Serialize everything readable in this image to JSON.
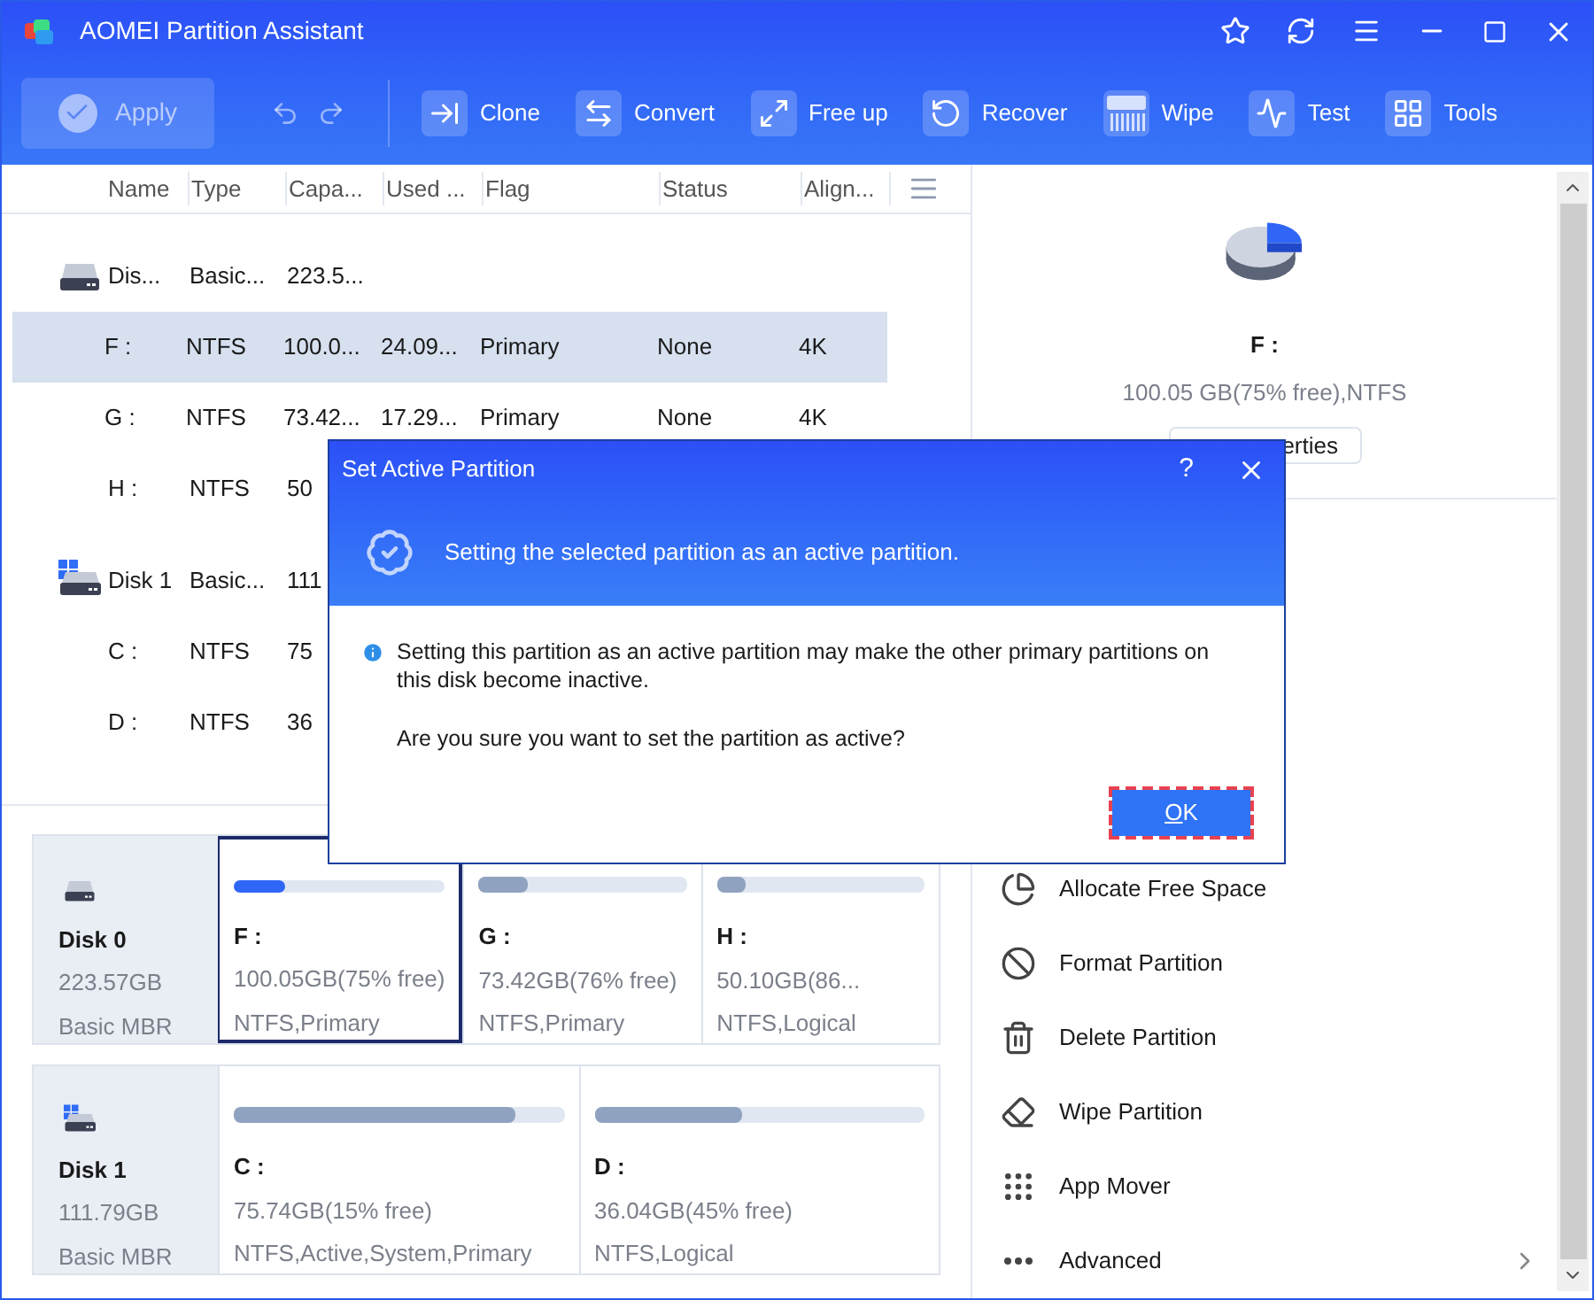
{
  "window": {
    "title": "AOMEI Partition Assistant"
  },
  "toolbar": {
    "apply": {
      "label": "Apply",
      "disabled": true
    },
    "items": [
      {
        "label": "Clone"
      },
      {
        "label": "Convert"
      },
      {
        "label": "Free up"
      },
      {
        "label": "Recover"
      },
      {
        "label": "Wipe"
      },
      {
        "label": "Test"
      },
      {
        "label": "Tools"
      }
    ]
  },
  "table": {
    "columns": [
      "Name",
      "Type",
      "Capa...",
      "Used ...",
      "Flag",
      "Status",
      "Align..."
    ],
    "rows": [
      {
        "kind": "disk",
        "selected": false,
        "cells": [
          "Dis...",
          "Basic...",
          "223.5..."
        ]
      },
      {
        "kind": "partition",
        "selected": true,
        "cells": [
          "F :",
          "NTFS",
          "100.0...",
          "24.09...",
          "Primary",
          "None",
          "4K"
        ]
      },
      {
        "kind": "partition",
        "selected": false,
        "cells": [
          "G :",
          "NTFS",
          "73.42...",
          "17.29...",
          "Primary",
          "None",
          "4K"
        ]
      },
      {
        "kind": "partition",
        "selected": false,
        "cells": [
          "H :",
          "NTFS",
          "50"
        ]
      },
      {
        "kind": "system_disk",
        "selected": false,
        "cells": [
          "Disk 1",
          "Basic...",
          "111"
        ]
      },
      {
        "kind": "partition",
        "selected": false,
        "cells": [
          "C :",
          "NTFS",
          "75"
        ]
      },
      {
        "kind": "partition",
        "selected": false,
        "cells": [
          "D :",
          "NTFS",
          "36"
        ]
      }
    ]
  },
  "disk_map": [
    {
      "kind": "disk",
      "name": "Disk 0",
      "size": "223.57GB",
      "style": "Basic MBR",
      "partitions": [
        {
          "label": "F :",
          "size": "100.05GB(75% free)",
          "info": "NTFS,Primary",
          "level": 0.24,
          "selected": true
        },
        {
          "label": "G :",
          "size": "73.42GB(76% free)",
          "info": "NTFS,Primary",
          "level": 0.24,
          "selected": false
        },
        {
          "label": "H :",
          "size": "50.10GB(86...",
          "info": "NTFS,Logical",
          "level": 0.14,
          "selected": false
        }
      ]
    },
    {
      "kind": "system_disk",
      "name": "Disk 1",
      "size": "111.79GB",
      "style": "Basic MBR",
      "partitions": [
        {
          "label": "C :",
          "size": "75.74GB(15% free)",
          "info": "NTFS,Active,System,Primary",
          "level": 0.85,
          "selected": false
        },
        {
          "label": "D :",
          "size": "36.04GB(45% free)",
          "info": "NTFS,Logical",
          "level": 0.45,
          "selected": false
        }
      ]
    }
  ],
  "details": {
    "drive": "F :",
    "info": "100.05 GB(75% free),NTFS",
    "properties_button": "erties"
  },
  "actions": [
    {
      "kind": "action",
      "label": "Allocate Free Space"
    },
    {
      "kind": "action",
      "label": "Format Partition"
    },
    {
      "kind": "action",
      "label": "Delete Partition"
    },
    {
      "kind": "action",
      "label": "Wipe Partition"
    },
    {
      "kind": "action",
      "label": "App Mover"
    },
    {
      "kind": "submenu",
      "label": "Advanced"
    }
  ],
  "dialog": {
    "title": "Set Active Partition",
    "help": "?",
    "header": "Setting the selected partition as an active partition.",
    "message": "Setting this partition as an active partition may make the other primary partitions on this disk become inactive.",
    "question": "Are you sure you want to set the partition as active?",
    "ok_button": {
      "label": "OK",
      "focused": true
    }
  }
}
